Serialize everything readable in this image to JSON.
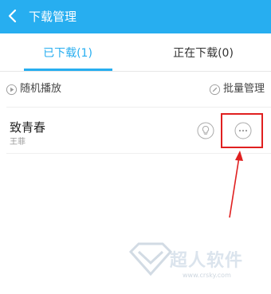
{
  "header": {
    "title": "下载管理",
    "back_icon": "chevron-left-icon"
  },
  "tabs": [
    {
      "label": "已下载(1)",
      "active": true
    },
    {
      "label": "正在下载(0)",
      "active": false
    }
  ],
  "actions": {
    "shuffle_label": "随机播放",
    "shuffle_icon": "play-circle-icon",
    "batch_label": "批量管理",
    "batch_icon": "edit-circle-icon"
  },
  "songs": [
    {
      "title": "致青春",
      "artist": "王菲",
      "icons": [
        "lightbulb-icon",
        "more-options-icon"
      ]
    }
  ],
  "watermark": {
    "text": "超人软件",
    "url": "www.crsky.com"
  },
  "colors": {
    "accent": "#27aef0",
    "annotation": "#e02020"
  }
}
